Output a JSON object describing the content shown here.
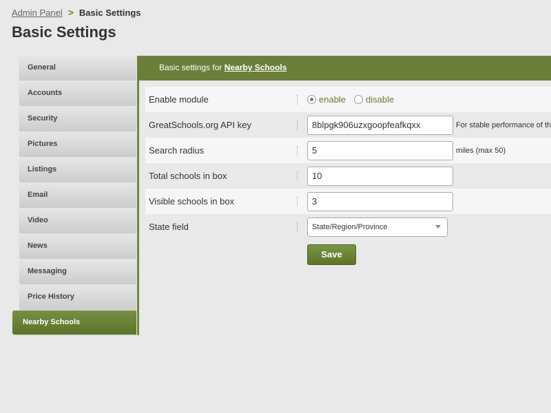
{
  "breadcrumb": {
    "parent": "Admin Panel",
    "separator": ">",
    "current": "Basic Settings"
  },
  "page_title": "Basic Settings",
  "sidebar": {
    "items": [
      {
        "label": "General"
      },
      {
        "label": "Accounts"
      },
      {
        "label": "Security"
      },
      {
        "label": "Pictures"
      },
      {
        "label": "Listings"
      },
      {
        "label": "Email"
      },
      {
        "label": "Video"
      },
      {
        "label": "News"
      },
      {
        "label": "Messaging"
      },
      {
        "label": "Price History"
      },
      {
        "label": "Nearby Schools",
        "active": true
      }
    ]
  },
  "main": {
    "header_prefix": "Basic settings for",
    "header_link": "Nearby Schools"
  },
  "form": {
    "enable_module": {
      "label": "Enable module",
      "options": [
        "enable",
        "disable"
      ],
      "selected": "enable"
    },
    "api_key": {
      "label": "GreatSchools.org API key",
      "value": "8blpgk906uzxgoopfeafkqxx",
      "hint": "For stable performance of th"
    },
    "search_radius": {
      "label": "Search radius",
      "value": "5",
      "hint": "miles (max 50)"
    },
    "total_schools": {
      "label": "Total schools in box",
      "value": "10"
    },
    "visible_schools": {
      "label": "Visible schools in box",
      "value": "3"
    },
    "state_field": {
      "label": "State field",
      "selected": "State/Region/Province"
    },
    "save_label": "Save"
  },
  "colors": {
    "accent": "#6b7f3a",
    "background": "#e9e9e9"
  }
}
